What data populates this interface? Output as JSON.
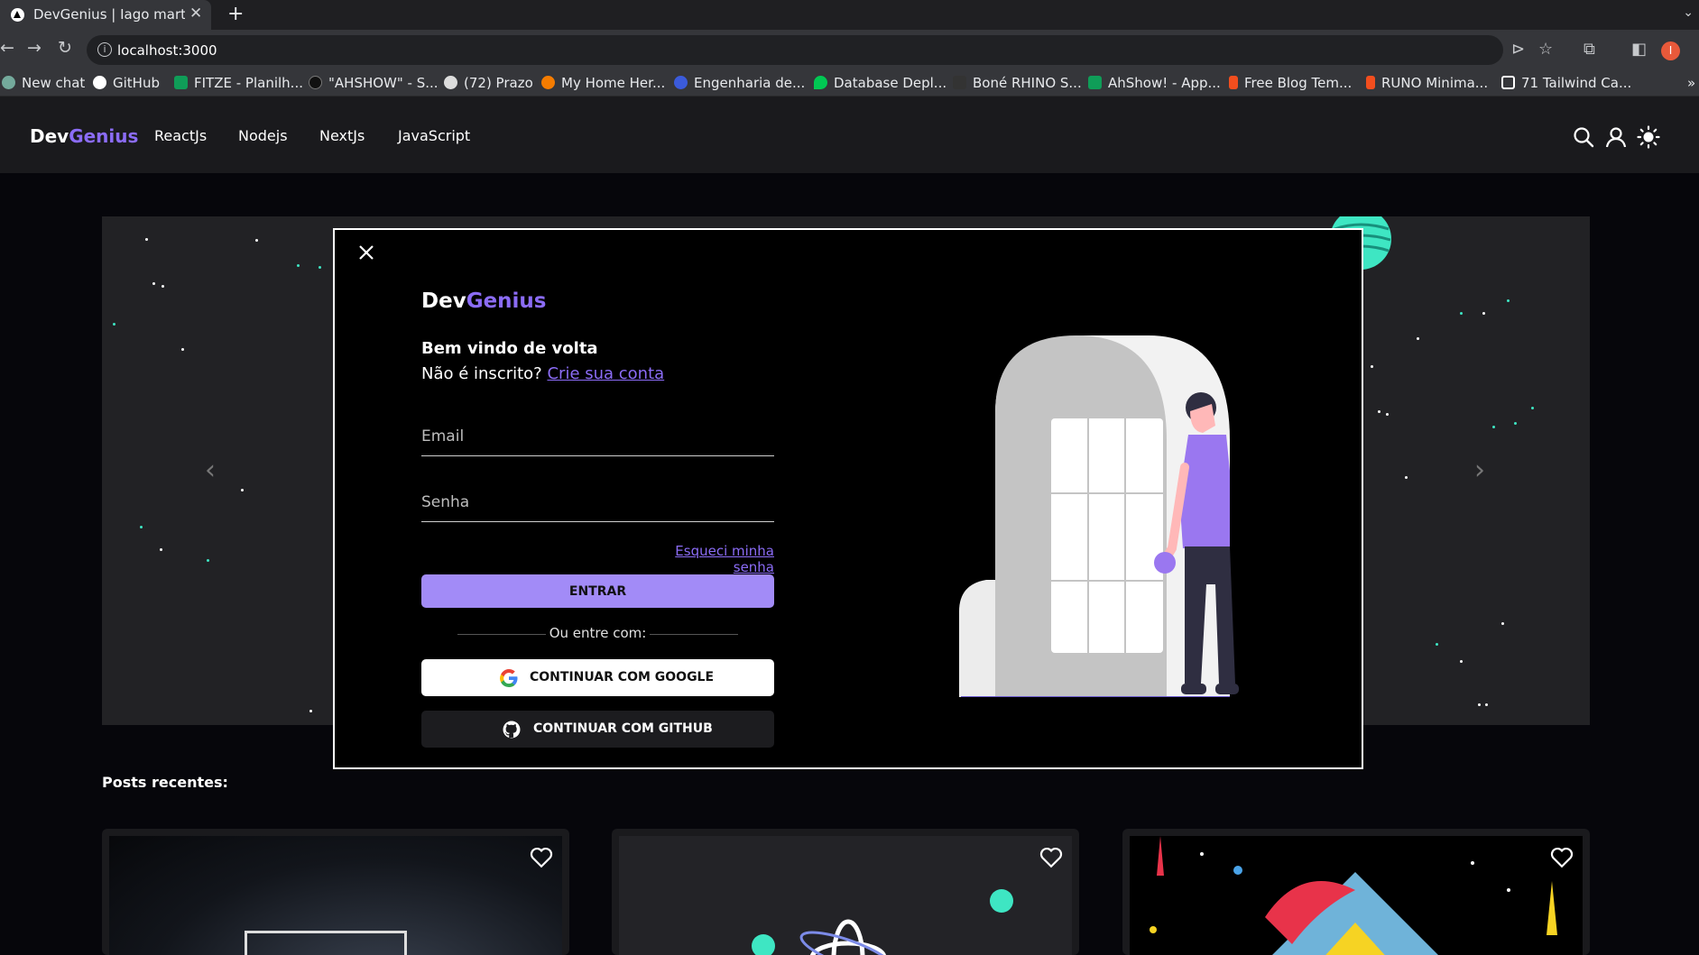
{
  "browser": {
    "tab_title": "DevGenius | Iago martins",
    "url": "localhost:3000",
    "profile_initial": "I",
    "bookmarks": [
      {
        "label": "New chat",
        "color": "#74aa9c"
      },
      {
        "label": "GitHub",
        "color": "#ffffff"
      },
      {
        "label": "FITZE - Planilh...",
        "color": "#0f9d58"
      },
      {
        "label": "\"AHSHOW\" - S...",
        "color": "#222222"
      },
      {
        "label": "(72) Prazo",
        "color": "#dddddd"
      },
      {
        "label": "My Home Her...",
        "color": "#f57c00"
      },
      {
        "label": "Engenharia de...",
        "color": "#3b5bdb"
      },
      {
        "label": "Database Depl...",
        "color": "#00c853"
      },
      {
        "label": "Boné RHINO S...",
        "color": "#333333"
      },
      {
        "label": "AhShow! - App...",
        "color": "#0f9d58"
      },
      {
        "label": "Free Blog Tem...",
        "color": "#f24e1e"
      },
      {
        "label": "RUNO Minima...",
        "color": "#f24e1e"
      },
      {
        "label": "71 Tailwind Ca...",
        "color": "#ffffff"
      }
    ]
  },
  "site": {
    "logo_dev": "Dev",
    "logo_genius": "Genius",
    "nav": [
      "ReactJs",
      "Nodejs",
      "NextJs",
      "JavaScript"
    ],
    "posts_title": "Posts recentes:"
  },
  "modal": {
    "logo_dev": "Dev",
    "logo_genius": "Genius",
    "welcome": "Bem vindo de volta",
    "not_registered": "Não é inscrito?",
    "create_account": "Crie sua conta",
    "email_placeholder": "Email",
    "password_placeholder": "Senha",
    "forgot": "Esqueci minha senha",
    "enter_button": "ENTRAR",
    "or_enter_with": "Ou entre com:",
    "google_button": "CONTINUAR COM GOOGLE",
    "github_button": "CONTINUAR COM GITHUB"
  },
  "colors": {
    "accent": "#8b6cf6",
    "button": "#a28bf7",
    "teal": "#3ee6c3"
  }
}
